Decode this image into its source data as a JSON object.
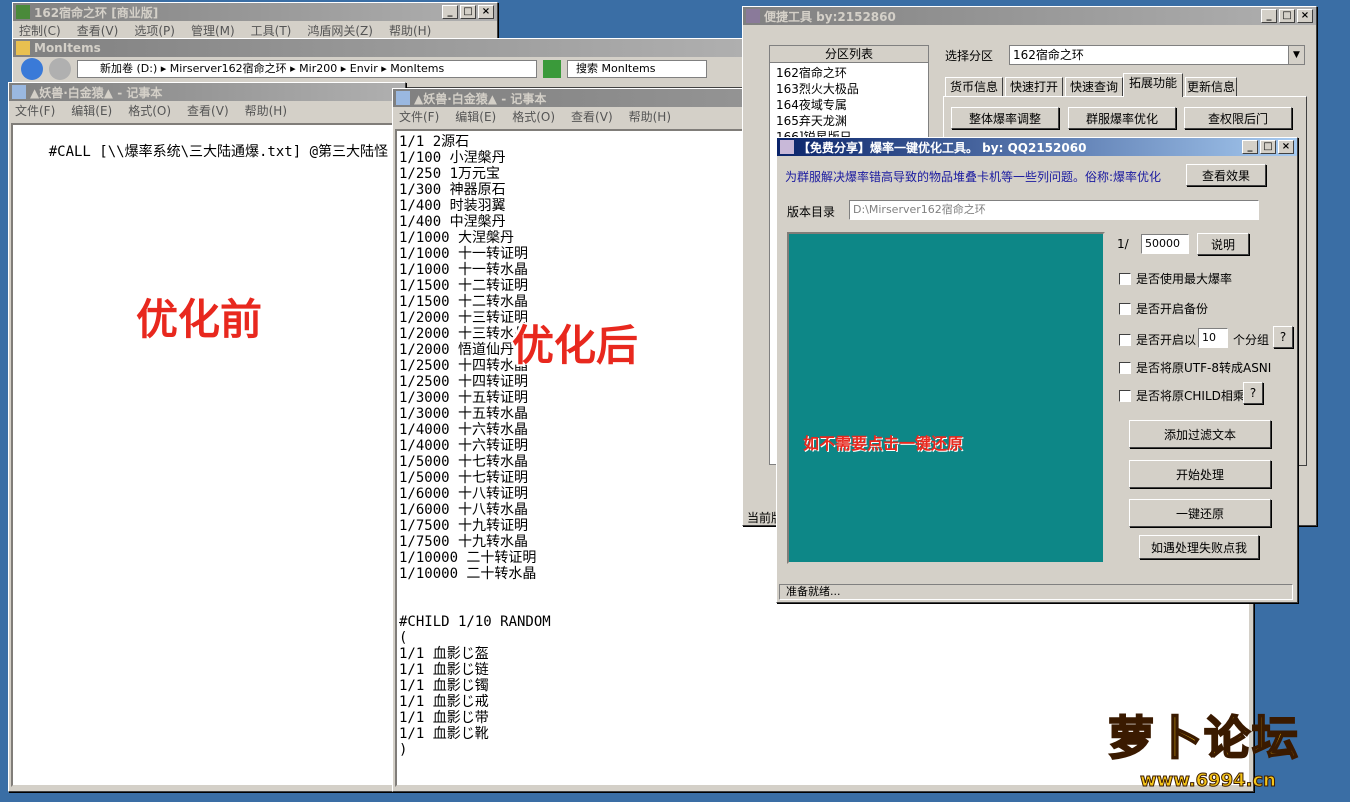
{
  "win1": {
    "title": "162宿命之环 [商业版]",
    "menu": [
      "控制(C)",
      "查看(V)",
      "选项(P)",
      "管理(M)",
      "工具(T)",
      "鸿盾网关(Z)",
      "帮助(H)"
    ]
  },
  "win2": {
    "title": "MonItems",
    "address": "新加卷 (D:) ▸ Mirserver162宿命之环 ▸ Mir200 ▸ Envir ▸ MonItems",
    "search": "搜索 MonItems"
  },
  "note1": {
    "title": "▲妖兽·白金猿▲ - 记事本",
    "menu": [
      "文件(F)",
      "编辑(E)",
      "格式(O)",
      "查看(V)",
      "帮助(H)"
    ],
    "text": "#CALL [\\\\爆率系统\\三大陆通爆.txt] @第三大陆怪"
  },
  "note2": {
    "title": "▲妖兽·白金猿▲ - 记事本",
    "menu": [
      "文件(F)",
      "编辑(E)",
      "格式(O)",
      "查看(V)",
      "帮助(H)"
    ],
    "lines": [
      "1/1 2源石",
      "1/100 小涅槃丹",
      "1/250 1万元宝",
      "1/300 神器原石",
      "1/400 时装羽翼",
      "1/400 中涅槃丹",
      "1/1000 大涅槃丹",
      "1/1000 十一转证明",
      "1/1000 十一转水晶",
      "1/1500 十二转证明",
      "1/1500 十二转水晶",
      "1/2000 十三转证明",
      "1/2000 十三转水晶",
      "1/2000 悟道仙丹",
      "1/2500 十四转水晶",
      "1/2500 十四转证明",
      "1/3000 十五转证明",
      "1/3000 十五转水晶",
      "1/4000 十六转水晶",
      "1/4000 十六转证明",
      "1/5000 十七转水晶",
      "1/5000 十七转证明",
      "1/6000 十八转证明",
      "1/6000 十八转水晶",
      "1/7500 十九转证明",
      "1/7500 十九转水晶",
      "1/10000 二十转证明",
      "1/10000 二十转水晶",
      "",
      "",
      "#CHILD 1/10 RANDOM",
      "(",
      "1/1 血影じ盔",
      "1/1 血影じ链",
      "1/1 血影じ镯",
      "1/1 血影じ戒",
      "1/1 血影じ带",
      "1/1 血影じ靴",
      ")"
    ]
  },
  "tool": {
    "title": "便捷工具  by:2152860",
    "list_header": "分区列表",
    "list": [
      "162宿命之环",
      "163烈火大极品",
      "164夜域专属",
      "165弃天龙渊",
      "166]锐星版日"
    ],
    "select_label": "选择分区",
    "select_value": "162宿命之环",
    "tabs": [
      "货币信息",
      "快速打开",
      "快速查询",
      "拓展功能",
      "更新信息"
    ],
    "buttons": [
      "整体爆率调整",
      "群服爆率优化",
      "查权限后门"
    ],
    "status": "当前版"
  },
  "opt": {
    "title": "【免费分享】爆率一键优化工具。  by: QQ2152060",
    "desc": "为群服解决爆率错高导致的物品堆叠卡机等一些列问题。俗称:爆率优化",
    "view_btn": "查看效果",
    "dir_label": "版本目录",
    "dir_value": "D:\\Mirserver162宿命之环",
    "rate_prefix": "1/",
    "rate_value": "50000",
    "explain_btn": "说明",
    "chk_max": "是否使用最大爆率",
    "chk_backup": "是否开启备份",
    "chk_group": "是否开启以",
    "group_value": "10",
    "group_suffix": "个分组",
    "help": "?",
    "chk_utf": "是否将原UTF-8转成ASNI",
    "chk_child": "是否将原CHILD相乘",
    "btn_filter": "添加过滤文本",
    "btn_start": "开始处理",
    "btn_restore": "一键还原",
    "btn_fail": "如遇处理失败点我",
    "panel_text": "如不需要点击一键还原",
    "status": "准备就绪..."
  },
  "overlay": {
    "before": "优化前",
    "after": "优化后"
  },
  "logo": {
    "text": "萝卜论坛",
    "url": "www.6994.cn"
  }
}
